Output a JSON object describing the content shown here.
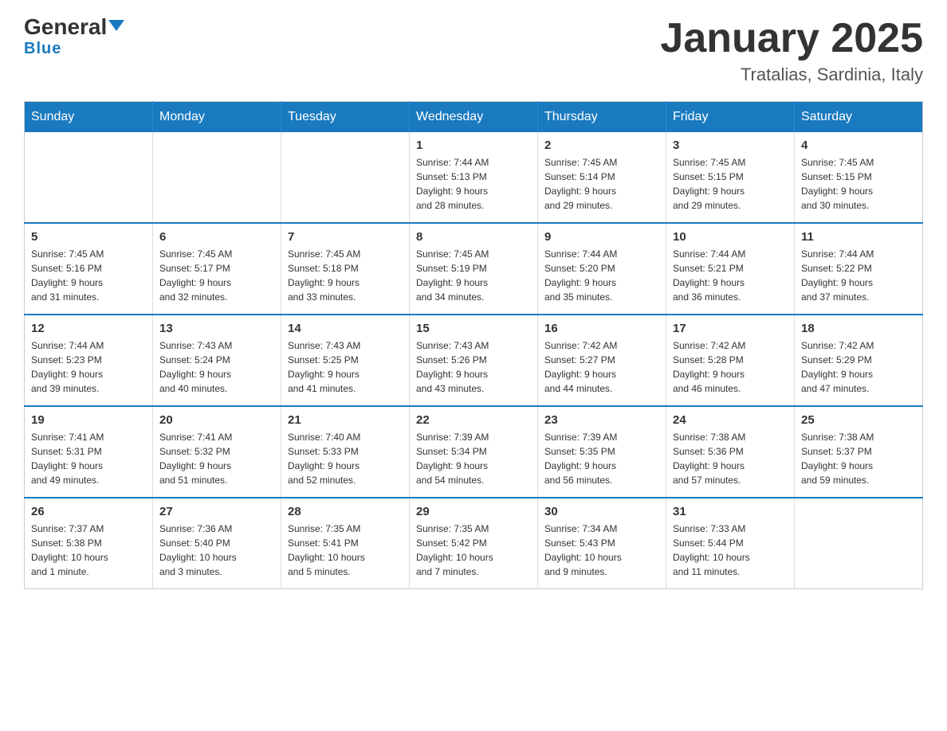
{
  "logo": {
    "general": "General",
    "blue": "Blue"
  },
  "header": {
    "title": "January 2025",
    "subtitle": "Tratalias, Sardinia, Italy"
  },
  "weekdays": [
    "Sunday",
    "Monday",
    "Tuesday",
    "Wednesday",
    "Thursday",
    "Friday",
    "Saturday"
  ],
  "weeks": [
    [
      {
        "day": "",
        "info": ""
      },
      {
        "day": "",
        "info": ""
      },
      {
        "day": "",
        "info": ""
      },
      {
        "day": "1",
        "info": "Sunrise: 7:44 AM\nSunset: 5:13 PM\nDaylight: 9 hours\nand 28 minutes."
      },
      {
        "day": "2",
        "info": "Sunrise: 7:45 AM\nSunset: 5:14 PM\nDaylight: 9 hours\nand 29 minutes."
      },
      {
        "day": "3",
        "info": "Sunrise: 7:45 AM\nSunset: 5:15 PM\nDaylight: 9 hours\nand 29 minutes."
      },
      {
        "day": "4",
        "info": "Sunrise: 7:45 AM\nSunset: 5:15 PM\nDaylight: 9 hours\nand 30 minutes."
      }
    ],
    [
      {
        "day": "5",
        "info": "Sunrise: 7:45 AM\nSunset: 5:16 PM\nDaylight: 9 hours\nand 31 minutes."
      },
      {
        "day": "6",
        "info": "Sunrise: 7:45 AM\nSunset: 5:17 PM\nDaylight: 9 hours\nand 32 minutes."
      },
      {
        "day": "7",
        "info": "Sunrise: 7:45 AM\nSunset: 5:18 PM\nDaylight: 9 hours\nand 33 minutes."
      },
      {
        "day": "8",
        "info": "Sunrise: 7:45 AM\nSunset: 5:19 PM\nDaylight: 9 hours\nand 34 minutes."
      },
      {
        "day": "9",
        "info": "Sunrise: 7:44 AM\nSunset: 5:20 PM\nDaylight: 9 hours\nand 35 minutes."
      },
      {
        "day": "10",
        "info": "Sunrise: 7:44 AM\nSunset: 5:21 PM\nDaylight: 9 hours\nand 36 minutes."
      },
      {
        "day": "11",
        "info": "Sunrise: 7:44 AM\nSunset: 5:22 PM\nDaylight: 9 hours\nand 37 minutes."
      }
    ],
    [
      {
        "day": "12",
        "info": "Sunrise: 7:44 AM\nSunset: 5:23 PM\nDaylight: 9 hours\nand 39 minutes."
      },
      {
        "day": "13",
        "info": "Sunrise: 7:43 AM\nSunset: 5:24 PM\nDaylight: 9 hours\nand 40 minutes."
      },
      {
        "day": "14",
        "info": "Sunrise: 7:43 AM\nSunset: 5:25 PM\nDaylight: 9 hours\nand 41 minutes."
      },
      {
        "day": "15",
        "info": "Sunrise: 7:43 AM\nSunset: 5:26 PM\nDaylight: 9 hours\nand 43 minutes."
      },
      {
        "day": "16",
        "info": "Sunrise: 7:42 AM\nSunset: 5:27 PM\nDaylight: 9 hours\nand 44 minutes."
      },
      {
        "day": "17",
        "info": "Sunrise: 7:42 AM\nSunset: 5:28 PM\nDaylight: 9 hours\nand 46 minutes."
      },
      {
        "day": "18",
        "info": "Sunrise: 7:42 AM\nSunset: 5:29 PM\nDaylight: 9 hours\nand 47 minutes."
      }
    ],
    [
      {
        "day": "19",
        "info": "Sunrise: 7:41 AM\nSunset: 5:31 PM\nDaylight: 9 hours\nand 49 minutes."
      },
      {
        "day": "20",
        "info": "Sunrise: 7:41 AM\nSunset: 5:32 PM\nDaylight: 9 hours\nand 51 minutes."
      },
      {
        "day": "21",
        "info": "Sunrise: 7:40 AM\nSunset: 5:33 PM\nDaylight: 9 hours\nand 52 minutes."
      },
      {
        "day": "22",
        "info": "Sunrise: 7:39 AM\nSunset: 5:34 PM\nDaylight: 9 hours\nand 54 minutes."
      },
      {
        "day": "23",
        "info": "Sunrise: 7:39 AM\nSunset: 5:35 PM\nDaylight: 9 hours\nand 56 minutes."
      },
      {
        "day": "24",
        "info": "Sunrise: 7:38 AM\nSunset: 5:36 PM\nDaylight: 9 hours\nand 57 minutes."
      },
      {
        "day": "25",
        "info": "Sunrise: 7:38 AM\nSunset: 5:37 PM\nDaylight: 9 hours\nand 59 minutes."
      }
    ],
    [
      {
        "day": "26",
        "info": "Sunrise: 7:37 AM\nSunset: 5:38 PM\nDaylight: 10 hours\nand 1 minute."
      },
      {
        "day": "27",
        "info": "Sunrise: 7:36 AM\nSunset: 5:40 PM\nDaylight: 10 hours\nand 3 minutes."
      },
      {
        "day": "28",
        "info": "Sunrise: 7:35 AM\nSunset: 5:41 PM\nDaylight: 10 hours\nand 5 minutes."
      },
      {
        "day": "29",
        "info": "Sunrise: 7:35 AM\nSunset: 5:42 PM\nDaylight: 10 hours\nand 7 minutes."
      },
      {
        "day": "30",
        "info": "Sunrise: 7:34 AM\nSunset: 5:43 PM\nDaylight: 10 hours\nand 9 minutes."
      },
      {
        "day": "31",
        "info": "Sunrise: 7:33 AM\nSunset: 5:44 PM\nDaylight: 10 hours\nand 11 minutes."
      },
      {
        "day": "",
        "info": ""
      }
    ]
  ]
}
